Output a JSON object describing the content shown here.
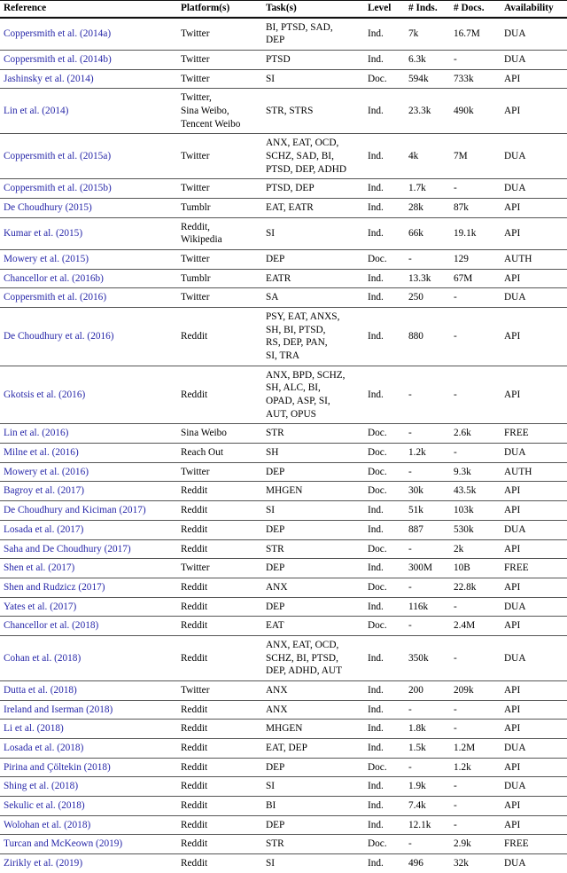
{
  "table": {
    "columns": [
      {
        "key": "reference",
        "label": "Reference"
      },
      {
        "key": "platforms",
        "label": "Platform(s)"
      },
      {
        "key": "tasks",
        "label": "Task(s)"
      },
      {
        "key": "level",
        "label": "Level"
      },
      {
        "key": "num_inds",
        "label": "# Inds."
      },
      {
        "key": "num_docs",
        "label": "# Docs."
      },
      {
        "key": "availability",
        "label": "Availability"
      }
    ],
    "link_color": "#2626a8",
    "rows": [
      {
        "reference": "Coppersmith et al. (2014a)",
        "platforms": [
          "Twitter"
        ],
        "tasks": [
          "BI, PTSD, SAD,",
          "DEP"
        ],
        "level": "Ind.",
        "num_inds": "7k",
        "num_docs": "16.7M",
        "availability": "DUA"
      },
      {
        "reference": "Coppersmith et al. (2014b)",
        "platforms": [
          "Twitter"
        ],
        "tasks": [
          "PTSD"
        ],
        "level": "Ind.",
        "num_inds": "6.3k",
        "num_docs": "-",
        "availability": "DUA"
      },
      {
        "reference": "Jashinsky et al. (2014)",
        "platforms": [
          "Twitter"
        ],
        "tasks": [
          "SI"
        ],
        "level": "Doc.",
        "num_inds": "594k",
        "num_docs": "733k",
        "availability": "API"
      },
      {
        "reference": "Lin et al. (2014)",
        "platforms": [
          "Twitter,",
          "Sina Weibo,",
          "Tencent Weibo"
        ],
        "tasks": [
          "STR, STRS"
        ],
        "level": "Ind.",
        "num_inds": "23.3k",
        "num_docs": "490k",
        "availability": "API"
      },
      {
        "reference": "Coppersmith et al. (2015a)",
        "platforms": [
          "Twitter"
        ],
        "tasks": [
          "ANX, EAT, OCD,",
          "SCHZ, SAD, BI,",
          "PTSD, DEP, ADHD"
        ],
        "level": "Ind.",
        "num_inds": "4k",
        "num_docs": "7M",
        "availability": "DUA"
      },
      {
        "reference": "Coppersmith et al. (2015b)",
        "platforms": [
          "Twitter"
        ],
        "tasks": [
          "PTSD, DEP"
        ],
        "level": "Ind.",
        "num_inds": "1.7k",
        "num_docs": "-",
        "availability": "DUA"
      },
      {
        "reference": "De Choudhury (2015)",
        "platforms": [
          "Tumblr"
        ],
        "tasks": [
          "EAT, EATR"
        ],
        "level": "Ind.",
        "num_inds": "28k",
        "num_docs": "87k",
        "availability": "API"
      },
      {
        "reference": "Kumar et al. (2015)",
        "platforms": [
          "Reddit,",
          "Wikipedia"
        ],
        "tasks": [
          "SI"
        ],
        "level": "Ind.",
        "num_inds": "66k",
        "num_docs": "19.1k",
        "availability": "API"
      },
      {
        "reference": "Mowery et al. (2015)",
        "platforms": [
          "Twitter"
        ],
        "tasks": [
          "DEP"
        ],
        "level": "Doc.",
        "num_inds": "-",
        "num_docs": "129",
        "availability": "AUTH"
      },
      {
        "reference": "Chancellor et al. (2016b)",
        "platforms": [
          "Tumblr"
        ],
        "tasks": [
          "EATR"
        ],
        "level": "Ind.",
        "num_inds": "13.3k",
        "num_docs": "67M",
        "availability": "API"
      },
      {
        "reference": "Coppersmith et al. (2016)",
        "platforms": [
          "Twitter"
        ],
        "tasks": [
          "SA"
        ],
        "level": "Ind.",
        "num_inds": "250",
        "num_docs": "-",
        "availability": "DUA"
      },
      {
        "reference": "De Choudhury et al. (2016)",
        "platforms": [
          "Reddit"
        ],
        "tasks": [
          "PSY, EAT, ANXS,",
          "SH, BI, PTSD,",
          "RS, DEP, PAN,",
          "SI, TRA"
        ],
        "level": "Ind.",
        "num_inds": "880",
        "num_docs": "-",
        "availability": "API"
      },
      {
        "reference": "Gkotsis et al. (2016)",
        "platforms": [
          "Reddit"
        ],
        "tasks": [
          "ANX, BPD, SCHZ,",
          "SH, ALC, BI,",
          "OPAD, ASP, SI,",
          "AUT, OPUS"
        ],
        "level": "Ind.",
        "num_inds": "-",
        "num_docs": "-",
        "availability": "API"
      },
      {
        "reference": "Lin et al. (2016)",
        "platforms": [
          "Sina Weibo"
        ],
        "tasks": [
          "STR"
        ],
        "level": "Doc.",
        "num_inds": "-",
        "num_docs": "2.6k",
        "availability": "FREE"
      },
      {
        "reference": "Milne et al. (2016)",
        "platforms": [
          "Reach Out"
        ],
        "tasks": [
          "SH"
        ],
        "level": "Doc.",
        "num_inds": "1.2k",
        "num_docs": "-",
        "availability": "DUA"
      },
      {
        "reference": "Mowery et al. (2016)",
        "platforms": [
          "Twitter"
        ],
        "tasks": [
          "DEP"
        ],
        "level": "Doc.",
        "num_inds": "-",
        "num_docs": "9.3k",
        "availability": "AUTH"
      },
      {
        "reference": "Bagroy et al. (2017)",
        "platforms": [
          "Reddit"
        ],
        "tasks": [
          "MHGEN"
        ],
        "level": "Doc.",
        "num_inds": "30k",
        "num_docs": "43.5k",
        "availability": "API"
      },
      {
        "reference": "De Choudhury and Kiciman (2017)",
        "platforms": [
          "Reddit"
        ],
        "tasks": [
          "SI"
        ],
        "level": "Ind.",
        "num_inds": "51k",
        "num_docs": "103k",
        "availability": "API"
      },
      {
        "reference": "Losada et al. (2017)",
        "platforms": [
          "Reddit"
        ],
        "tasks": [
          "DEP"
        ],
        "level": "Ind.",
        "num_inds": "887",
        "num_docs": "530k",
        "availability": "DUA"
      },
      {
        "reference": "Saha and De Choudhury (2017)",
        "platforms": [
          "Reddit"
        ],
        "tasks": [
          "STR"
        ],
        "level": "Doc.",
        "num_inds": "-",
        "num_docs": "2k",
        "availability": "API"
      },
      {
        "reference": "Shen et al. (2017)",
        "platforms": [
          "Twitter"
        ],
        "tasks": [
          "DEP"
        ],
        "level": "Ind.",
        "num_inds": "300M",
        "num_docs": "10B",
        "availability": "FREE"
      },
      {
        "reference": "Shen and Rudzicz (2017)",
        "platforms": [
          "Reddit"
        ],
        "tasks": [
          "ANX"
        ],
        "level": "Doc.",
        "num_inds": "-",
        "num_docs": "22.8k",
        "availability": "API"
      },
      {
        "reference": "Yates et al. (2017)",
        "platforms": [
          "Reddit"
        ],
        "tasks": [
          "DEP"
        ],
        "level": "Ind.",
        "num_inds": "116k",
        "num_docs": "-",
        "availability": "DUA"
      },
      {
        "reference": "Chancellor et al. (2018)",
        "platforms": [
          "Reddit"
        ],
        "tasks": [
          "EAT"
        ],
        "level": "Doc.",
        "num_inds": "-",
        "num_docs": "2.4M",
        "availability": "API"
      },
      {
        "reference": "Cohan et al. (2018)",
        "platforms": [
          "Reddit"
        ],
        "tasks": [
          "ANX, EAT, OCD,",
          "SCHZ, BI, PTSD,",
          "DEP, ADHD, AUT"
        ],
        "level": "Ind.",
        "num_inds": "350k",
        "num_docs": "-",
        "availability": "DUA"
      },
      {
        "reference": "Dutta et al. (2018)",
        "platforms": [
          "Twitter"
        ],
        "tasks": [
          "ANX"
        ],
        "level": "Ind.",
        "num_inds": "200",
        "num_docs": "209k",
        "availability": "API"
      },
      {
        "reference": "Ireland and Iserman (2018)",
        "platforms": [
          "Reddit"
        ],
        "tasks": [
          "ANX"
        ],
        "level": "Ind.",
        "num_inds": "-",
        "num_docs": "-",
        "availability": "API"
      },
      {
        "reference": "Li et al. (2018)",
        "platforms": [
          "Reddit"
        ],
        "tasks": [
          "MHGEN"
        ],
        "level": "Ind.",
        "num_inds": "1.8k",
        "num_docs": "-",
        "availability": "API"
      },
      {
        "reference": "Losada et al. (2018)",
        "platforms": [
          "Reddit"
        ],
        "tasks": [
          "EAT, DEP"
        ],
        "level": "Ind.",
        "num_inds": "1.5k",
        "num_docs": "1.2M",
        "availability": "DUA"
      },
      {
        "reference": "Pirina and Çöltekin (2018)",
        "platforms": [
          "Reddit"
        ],
        "tasks": [
          "DEP"
        ],
        "level": "Doc.",
        "num_inds": "-",
        "num_docs": "1.2k",
        "availability": "API"
      },
      {
        "reference": "Shing et al. (2018)",
        "platforms": [
          "Reddit"
        ],
        "tasks": [
          "SI"
        ],
        "level": "Ind.",
        "num_inds": "1.9k",
        "num_docs": "-",
        "availability": "DUA"
      },
      {
        "reference": "Sekulic et al. (2018)",
        "platforms": [
          "Reddit"
        ],
        "tasks": [
          "BI"
        ],
        "level": "Ind.",
        "num_inds": "7.4k",
        "num_docs": "-",
        "availability": "API"
      },
      {
        "reference": "Wolohan et al. (2018)",
        "platforms": [
          "Reddit"
        ],
        "tasks": [
          "DEP"
        ],
        "level": "Ind.",
        "num_inds": "12.1k",
        "num_docs": "-",
        "availability": "API"
      },
      {
        "reference": "Turcan and McKeown (2019)",
        "platforms": [
          "Reddit"
        ],
        "tasks": [
          "STR"
        ],
        "level": "Doc.",
        "num_inds": "-",
        "num_docs": "2.9k",
        "availability": "FREE"
      },
      {
        "reference": "Zirikly et al. (2019)",
        "platforms": [
          "Reddit"
        ],
        "tasks": [
          "SI"
        ],
        "level": "Ind.",
        "num_inds": "496",
        "num_docs": "32k",
        "availability": "DUA"
      }
    ]
  }
}
